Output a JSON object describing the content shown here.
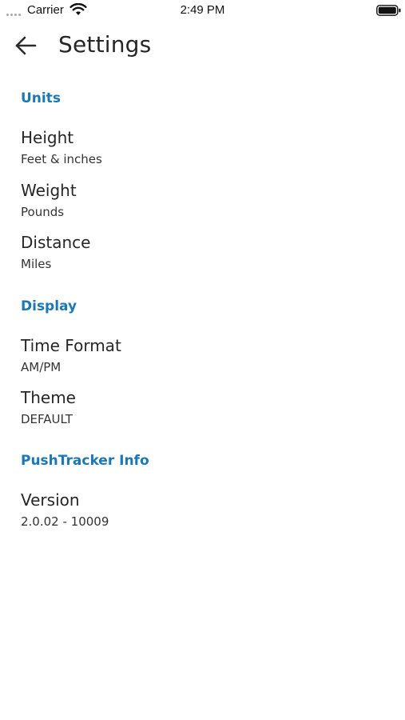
{
  "status_bar": {
    "carrier": "Carrier",
    "time": "2:49 PM",
    "signal_icon": "signal-dots-icon",
    "wifi_icon": "wifi-icon",
    "battery_icon": "battery-icon"
  },
  "app_bar": {
    "title": "Settings",
    "back_icon": "arrow-left-icon"
  },
  "sections": [
    {
      "header": "Units",
      "items": [
        {
          "title": "Height",
          "value": "Feet & inches"
        },
        {
          "title": "Weight",
          "value": "Pounds"
        },
        {
          "title": "Distance",
          "value": "Miles"
        }
      ]
    },
    {
      "header": "Display",
      "items": [
        {
          "title": "Time Format",
          "value": "AM/PM"
        },
        {
          "title": "Theme",
          "value": "DEFAULT"
        }
      ]
    },
    {
      "header": "PushTracker Info",
      "items": [
        {
          "title": "Version",
          "value": "2.0.02 - 10009"
        }
      ]
    }
  ],
  "colors": {
    "accent": "#1c78b4",
    "text": "#262626",
    "background": "#ffffff"
  }
}
